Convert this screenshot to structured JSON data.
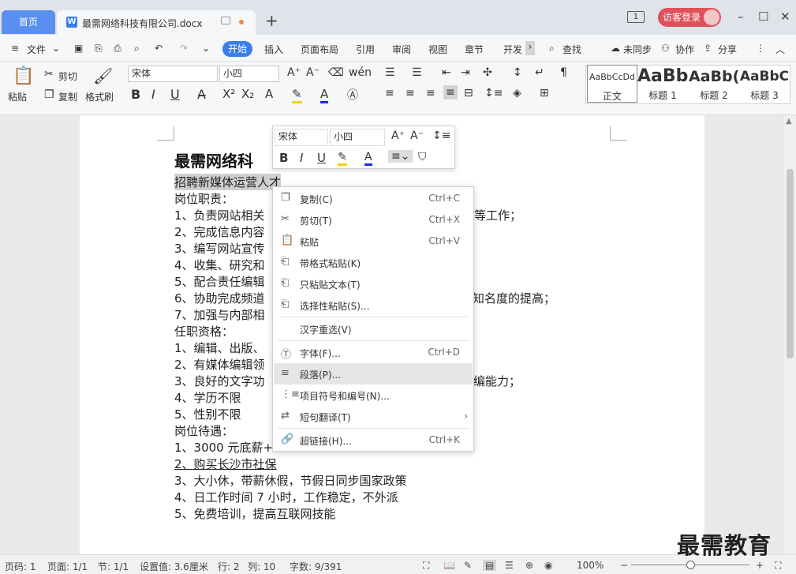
{
  "tabs": {
    "home": "首页",
    "doc": "最需网络科技有限公司.docx",
    "page_indicator": "1",
    "login": "访客登录"
  },
  "menu": {
    "file": "文件",
    "start": "开始",
    "insert": "插入",
    "layout": "页面布局",
    "reference": "引用",
    "review": "审阅",
    "view": "视图",
    "chapter": "章节",
    "dev": "开发",
    "search": "查找",
    "unsync": "未同步",
    "collab": "协作",
    "share": "分享"
  },
  "ribbon": {
    "paste": "粘贴",
    "cut": "剪切",
    "copy": "复制",
    "format_painter": "格式刷",
    "font": "宋体",
    "size": "小四",
    "styles": [
      {
        "sample": "AaBbCcDd",
        "name": "正文"
      },
      {
        "sample": "AaBb",
        "name": "标题 1"
      },
      {
        "sample": "AaBb(",
        "name": "标题 2"
      },
      {
        "sample": "AaBbC",
        "name": "标题 3"
      }
    ]
  },
  "minibar": {
    "font": "宋体",
    "size": "小四"
  },
  "doc": {
    "title": "最需网络科",
    "lines": [
      "招聘新媒体运营人才",
      "岗位职责：",
      "1、负责网站相关",
      "2、完成信息内容",
      "3、编写网站宣传",
      "4、收集、研究和",
      "5、配合责任编辑",
      "6、协助完成频道",
      "7、加强与内部相",
      "任职资格：",
      "1、编辑、出版、",
      "2、有媒体编辑领",
      "3、良好的文字功",
      "4、学历不限",
      "5、性别不限",
      "岗位待遇：",
      "1、3000 元底薪+",
      "2、购买长沙市社保",
      "3、大小休，带薪休假，节假日同步国家政策",
      "4、日工作时间 7 小时，工作稳定，不外派",
      "5、免费培训，提高互联网技能"
    ],
    "tail1": "等工作；",
    "tail6": "知名度的提高；",
    "tail12": "编能力；"
  },
  "context_menu": [
    {
      "label": "复制(C)",
      "shortcut": "Ctrl+C",
      "icon": "copy-icon"
    },
    {
      "label": "剪切(T)",
      "shortcut": "Ctrl+X",
      "icon": "cut-icon"
    },
    {
      "label": "粘贴",
      "shortcut": "Ctrl+V",
      "icon": "paste-icon"
    },
    {
      "label": "带格式粘贴(K)",
      "shortcut": "",
      "icon": "paste-format-icon"
    },
    {
      "label": "只粘贴文本(T)",
      "shortcut": "",
      "icon": "paste-text-icon"
    },
    {
      "label": "选择性粘贴(S)...",
      "shortcut": "",
      "icon": "paste-special-icon"
    },
    {
      "label": "汉字重选(V)",
      "shortcut": "",
      "icon": ""
    },
    {
      "label": "字体(F)...",
      "shortcut": "Ctrl+D",
      "icon": "font-icon"
    },
    {
      "label": "段落(P)...",
      "shortcut": "",
      "icon": "paragraph-icon"
    },
    {
      "label": "项目符号和编号(N)...",
      "shortcut": "",
      "icon": "bullets-icon"
    },
    {
      "label": "短句翻译(T)",
      "shortcut": "",
      "icon": "translate-icon"
    },
    {
      "label": "超链接(H)...",
      "shortcut": "Ctrl+K",
      "icon": "link-icon"
    }
  ],
  "status": {
    "page_no": "页码: 1",
    "pages": "页面: 1/1",
    "section": "节: 1/1",
    "setting": "设置值: 3.6厘米",
    "row": "行: 2",
    "col": "列: 10",
    "words": "字数: 9/391",
    "zoom": "100%"
  },
  "watermark": "最需教育"
}
